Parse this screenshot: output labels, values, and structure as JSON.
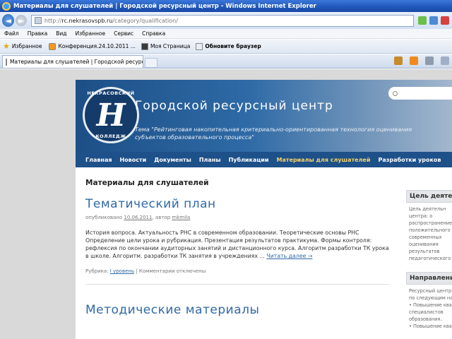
{
  "window": {
    "title": "Материалы для слушателей | Городской ресурсный центр - Windows Internet Explorer"
  },
  "address": {
    "url_prefix": "http://",
    "url_host": "rc.nekrasovspb.ru",
    "url_path": "/category/qualification/"
  },
  "menu": [
    "Файл",
    "Правка",
    "Вид",
    "Избранное",
    "Сервис",
    "Справка"
  ],
  "favorites": {
    "label": "Избранное",
    "items": [
      "Конференция.24.10.2011 ...",
      "Моя Страница",
      "Обновите браузер"
    ]
  },
  "tab": {
    "label": "Материалы для слушателей | Городской ресурсны..."
  },
  "site": {
    "title": "Городской ресурсный центр",
    "subtitle_line1": "Тема \"Рейтинговая накопительная критериально-ориентированная технология оценивания",
    "subtitle_line2": "субъектов образовательного процесса\"",
    "logo_top": "НЕКРАСОВСКИЙ",
    "logo_bottom": "КОЛЛЕДЖ",
    "logo_letter": "Н",
    "nav": [
      "Главная",
      "Новости",
      "Документы",
      "Планы",
      "Публикации",
      "Материалы для слушателей",
      "Разработки уроков"
    ],
    "nav_active": "Материалы для слушателей"
  },
  "content": {
    "category_title": "Материалы для слушателей",
    "post1": {
      "title": "Тематический план",
      "meta_prefix": "опубликовано",
      "date": "10.06.2011",
      "meta_mid": ", автор",
      "author": "mkmila",
      "body": "История вопроса. Актуальность РНС в современном образовании. Теоретические основы РНС Определение цели урока и рубрикация. Презентация результатов практикума. Формы контроля: рефлексия по окончании аудиторных занятий и дистанционного курса. Алгоритм разработки ТК урока в школе. Алгоритм. разработки ТК занятия в учреждениях ...",
      "more": "Читать далее →",
      "footer_prefix": "Рубрика:",
      "footer_cat": "I уровень",
      "footer_suffix": "| Комментарии отключены"
    },
    "post2": {
      "title": "Методические материалы"
    }
  },
  "sidebar": {
    "widget1_title": "Цель деяте",
    "widget1_lines": [
      "Цель деятельн",
      "центра: о",
      "распространение",
      "положительного",
      "современных",
      "оценивания",
      "результатов",
      "педагогического"
    ],
    "widget2_title": "Направлени",
    "widget2_lines": [
      "Ресурсный центр",
      "по следующим на",
      "• Повышение ква",
      "специалистов",
      "образования.",
      "• Повышение ква"
    ]
  }
}
